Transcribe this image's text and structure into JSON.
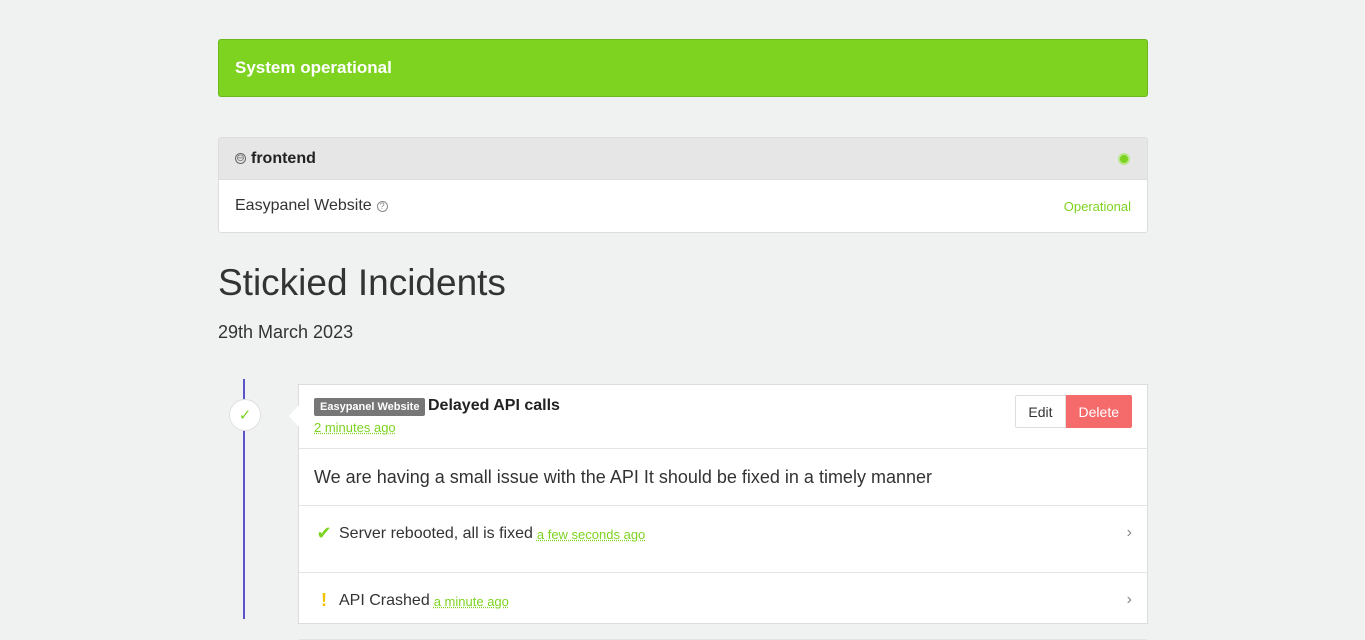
{
  "banner": {
    "text": "System operational"
  },
  "group": {
    "collapse_icon": "⊖",
    "title": "frontend",
    "dot_color": "#7ed321",
    "component": {
      "name": "Easypanel Website",
      "help_icon": "?",
      "status": "Operational"
    }
  },
  "stickied": {
    "title": "Stickied Incidents",
    "date": "29th March 2023"
  },
  "incident": {
    "badge_icon": "✓",
    "tag": "Easypanel Website",
    "title": "Delayed API calls",
    "time": "2 minutes ago",
    "edit_label": "Edit",
    "delete_label": "Delete",
    "body": "We are having a small issue with the API It should be fixed in a timely manner",
    "updates": [
      {
        "icon": "✔",
        "text": "Server rebooted, all is fixed",
        "time": "a few seconds ago"
      },
      {
        "icon": "!",
        "text": "API Crashed",
        "time": "a minute ago"
      }
    ]
  },
  "colors": {
    "accent": "#7ed321",
    "timeline": "#5b54c8",
    "danger": "#f56a6a",
    "warning": "#f5c200"
  }
}
